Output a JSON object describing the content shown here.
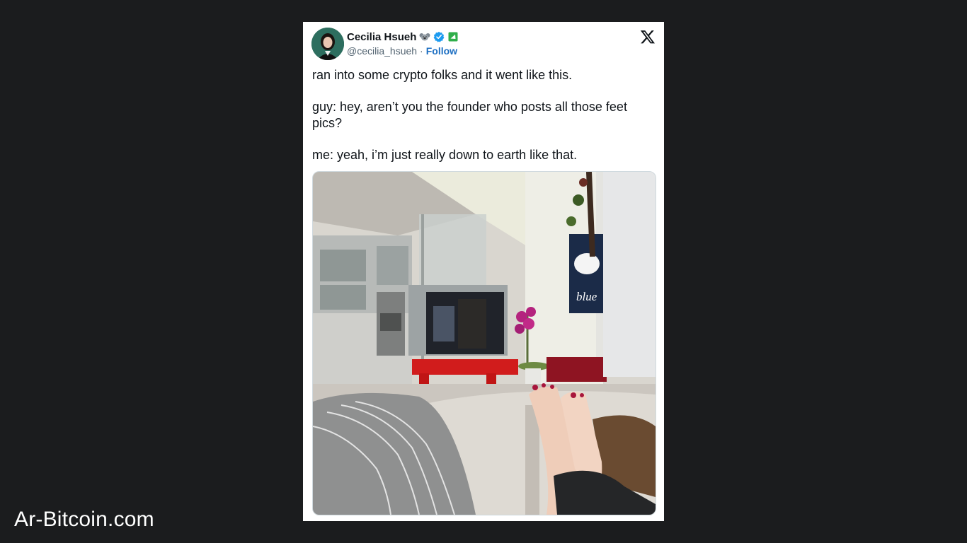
{
  "tweet": {
    "author_name": "Cecilia Hsueh",
    "handle": "@cecilia_hsueh",
    "separator": "·",
    "follow_label": "Follow",
    "paragraphs": [
      "ran into some crypto folks and it went like this.",
      "guy: hey, aren’t you the founder who posts all those feet pics?",
      "me: yeah, i’m just really down to earth like that."
    ],
    "badges": [
      "koala-emoji-icon",
      "verified-badge-icon",
      "green-chat-icon"
    ],
    "media_alt_poster": "blue"
  },
  "watermark": {
    "text": "Ar-Bitcoin.com"
  },
  "colors": {
    "page_background": "#1b1c1e",
    "card_background": "#ffffff",
    "follow_link": "#1d6fc2",
    "verified_blue": "#1d9bf0",
    "text_primary": "#0f1419",
    "text_secondary": "#536471"
  }
}
